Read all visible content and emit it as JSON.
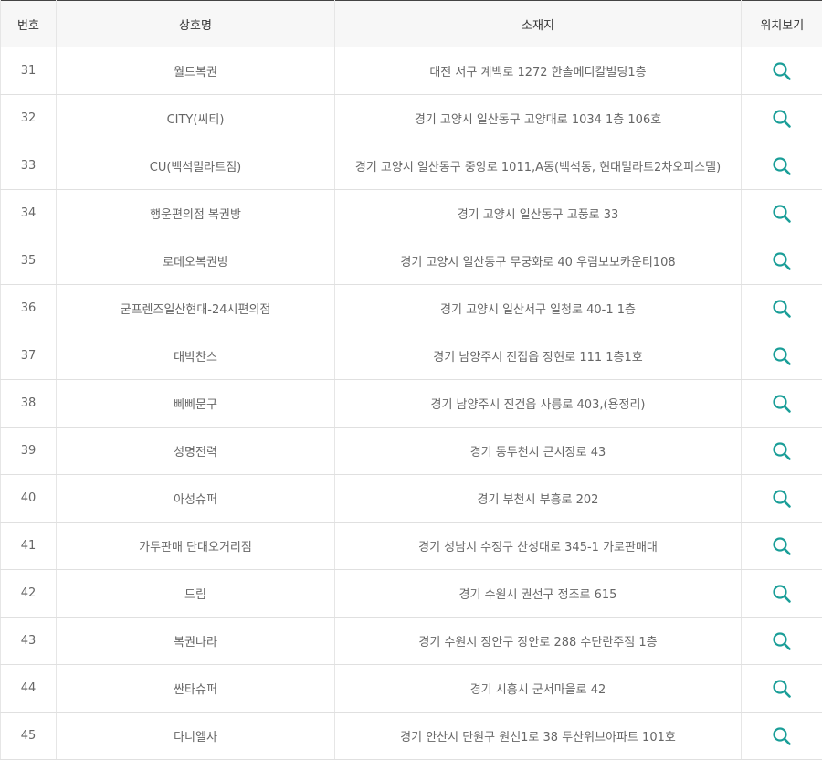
{
  "table": {
    "headers": {
      "number": "번호",
      "store_name": "상호명",
      "address": "소재지",
      "location": "위치보기"
    },
    "accent_color": "#1a9e98",
    "location_icon": "search-icon",
    "rows": [
      {
        "number": "31",
        "name": "월드복권",
        "address": "대전 서구 계백로 1272 한솔메디칼빌딩1층"
      },
      {
        "number": "32",
        "name": "CITY(씨티)",
        "address": "경기 고양시 일산동구 고양대로 1034 1층 106호"
      },
      {
        "number": "33",
        "name": "CU(백석밀라트점)",
        "address": "경기 고양시 일산동구 중앙로 1011,A동(백석동, 현대밀라트2차오피스텔)"
      },
      {
        "number": "34",
        "name": "행운편의점 복권방",
        "address": "경기 고양시 일산동구 고풍로 33"
      },
      {
        "number": "35",
        "name": "로데오복권방",
        "address": "경기 고양시 일산동구 무궁화로 40 우림보보카운티108"
      },
      {
        "number": "36",
        "name": "굳프렌즈일산현대-24시편의점",
        "address": "경기 고양시 일산서구 일청로 40-1 1층"
      },
      {
        "number": "37",
        "name": "대박찬스",
        "address": "경기 남양주시 진접읍 장현로 111 1층1호"
      },
      {
        "number": "38",
        "name": "삐삐문구",
        "address": "경기 남양주시 진건읍 사릉로 403,(용정리)"
      },
      {
        "number": "39",
        "name": "성명전력",
        "address": "경기 동두천시 큰시장로 43"
      },
      {
        "number": "40",
        "name": "아성슈퍼",
        "address": "경기 부천시 부흥로 202"
      },
      {
        "number": "41",
        "name": "가두판매 단대오거리점",
        "address": "경기 성남시 수정구 산성대로 345-1 가로판매대"
      },
      {
        "number": "42",
        "name": "드림",
        "address": "경기 수원시 권선구 정조로 615"
      },
      {
        "number": "43",
        "name": "복권나라",
        "address": "경기 수원시 장안구 장안로 288 수단란주점 1층"
      },
      {
        "number": "44",
        "name": "싼타슈퍼",
        "address": "경기 시흥시 군서마을로 42"
      },
      {
        "number": "45",
        "name": "다니엘사",
        "address": "경기 안산시 단원구 원선1로 38 두산위브아파트 101호"
      }
    ]
  }
}
